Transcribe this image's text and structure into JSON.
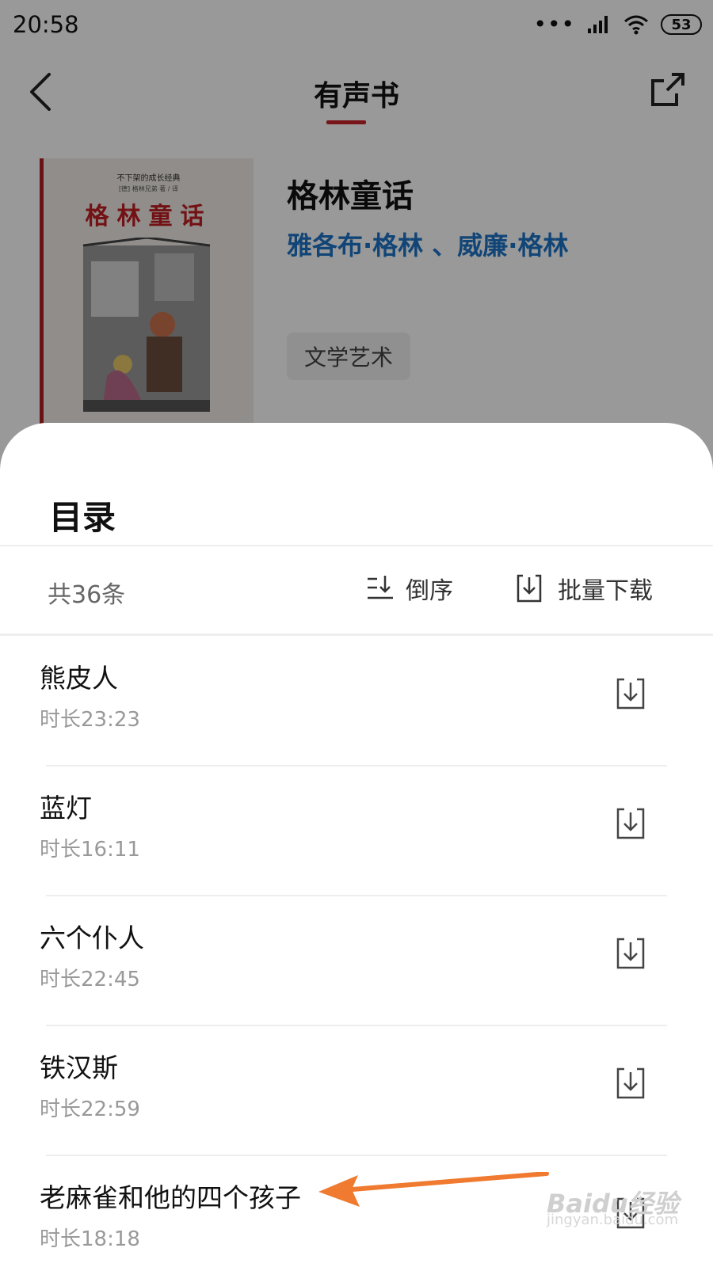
{
  "status": {
    "time": "20:58",
    "battery": "53"
  },
  "topbar": {
    "title": "有声书"
  },
  "book": {
    "cover_top": "不下架的成长经典",
    "cover_sub": "[德] 格林兄弟 著 / 译",
    "cover_title": "格林童话",
    "name": "格林童话",
    "author": "雅各布·格林 、威廉·格林",
    "tag": "文学艺术"
  },
  "sheet": {
    "title": "目录",
    "count": "共36条",
    "sort_label": "倒序",
    "batch_label": "批量下载"
  },
  "items": [
    {
      "title": "熊皮人",
      "duration": "时长23:23"
    },
    {
      "title": "蓝灯",
      "duration": "时长16:11"
    },
    {
      "title": "六个仆人",
      "duration": "时长22:45"
    },
    {
      "title": "铁汉斯",
      "duration": "时长22:59"
    },
    {
      "title": "老麻雀和他的四个孩子",
      "duration": "时长18:18"
    }
  ],
  "watermark": {
    "main": "Baidu经验",
    "sub": "jingyan.baidu.com"
  },
  "colors": {
    "accent": "#c8242b",
    "author": "#1d74c6",
    "arrow": "#f07a2f"
  },
  "icons": [
    "back-icon",
    "share-icon",
    "sort-icon",
    "batch-download-icon",
    "download-icon",
    "wifi-icon",
    "signal-icon"
  ]
}
